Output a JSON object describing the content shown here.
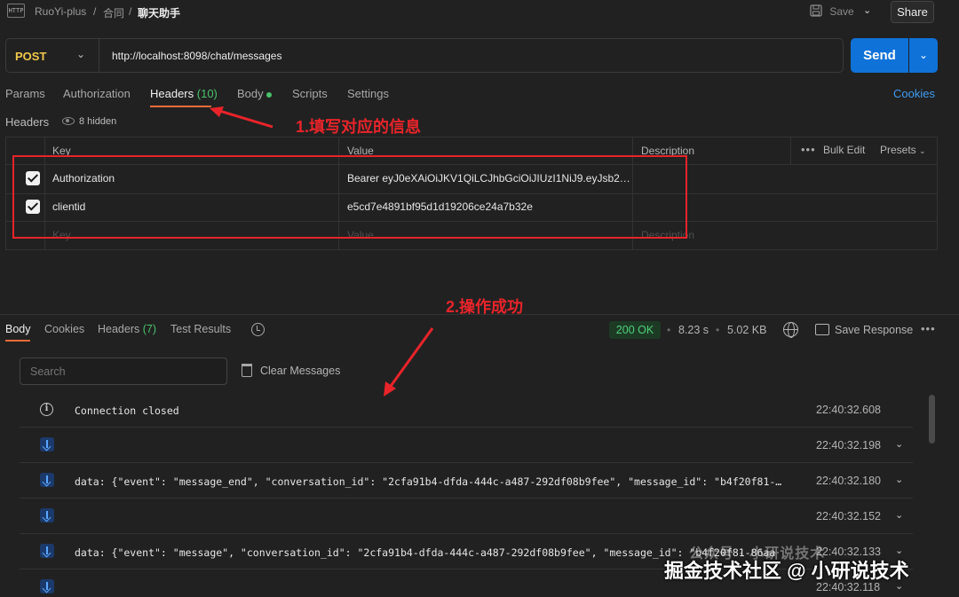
{
  "top_bar": {
    "app_icon_text": "HTTP",
    "breadcrumb": [
      "RuoYi-plus",
      "合同",
      "聊天助手"
    ],
    "save_label": "Save",
    "share_label": "Share"
  },
  "request": {
    "method": "POST",
    "url": "http://localhost:8098/chat/messages",
    "send_label": "Send"
  },
  "request_tabs": {
    "params": "Params",
    "authorization": "Authorization",
    "headers": "Headers",
    "headers_count": "(10)",
    "body": "Body",
    "scripts": "Scripts",
    "settings": "Settings",
    "cookies": "Cookies"
  },
  "headers_section": {
    "label": "Headers",
    "hidden": "8 hidden",
    "columns": {
      "key": "Key",
      "value": "Value",
      "description": "Description"
    },
    "bulk_edit": "Bulk Edit",
    "presets": "Presets",
    "rows": [
      {
        "key": "Authorization",
        "value": "Bearer eyJ0eXAiOiJKV1QiLCJhbGciOiJIUzI1NiJ9.eyJsb2…",
        "checked": true
      },
      {
        "key": "clientid",
        "value": "e5cd7e4891bf95d1d19206ce24a7b32e",
        "checked": true
      }
    ],
    "placeholder": {
      "key": "Key",
      "value": "Value",
      "description": "Description"
    }
  },
  "annotations": {
    "note1": "1.填写对应的信息",
    "note2": "2.操作成功",
    "color": "#e8242a"
  },
  "response": {
    "tabs": {
      "body": "Body",
      "cookies": "Cookies",
      "headers": "Headers",
      "headers_count": "(7)",
      "test_results": "Test Results"
    },
    "status": "200 OK",
    "time": "8.23 s",
    "size": "5.02 KB",
    "save_response": "Save Response",
    "search_placeholder": "Search",
    "clear_messages": "Clear Messages",
    "messages": [
      {
        "icon": "info",
        "text": "Connection closed",
        "time": "22:40:32.608",
        "expandable": false
      },
      {
        "icon": "down",
        "text": "",
        "time": "22:40:32.198",
        "expandable": true
      },
      {
        "icon": "down",
        "text": "data: {\"event\": \"message_end\", \"conversation_id\": \"2cfa91b4-dfda-444c-a487-292df08b9fee\", \"message_id\": \"b4f20f81-…",
        "time": "22:40:32.180",
        "expandable": true
      },
      {
        "icon": "down",
        "text": "",
        "time": "22:40:32.152",
        "expandable": true
      },
      {
        "icon": "down",
        "text": "data: {\"event\": \"message\", \"conversation_id\": \"2cfa91b4-dfda-444c-a487-292df08b9fee\", \"message_id\": \"b4f20f81-86aa",
        "time": "22:40:32.133",
        "expandable": true
      },
      {
        "icon": "down",
        "text": "",
        "time": "22:40:32.118",
        "expandable": true
      }
    ]
  },
  "watermark": {
    "faint": "公众号 · 小研说技术",
    "main": "掘金技术社区 @ 小研说技术"
  },
  "colors": {
    "accent": "#0f72d8",
    "tab_underline": "#f26b3a",
    "method": "#f2c84b",
    "success": "#4fd07a"
  }
}
